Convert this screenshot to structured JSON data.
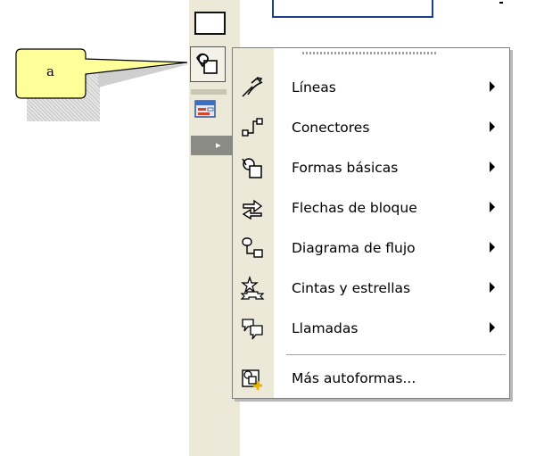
{
  "callout": {
    "label": "a"
  },
  "toolbar": {
    "rectangle_icon": "rectangle-icon",
    "autoshapes_icon": "autoshapes-icon",
    "form_icon": "form-icon",
    "overflow_icon": "overflow-arrow-icon"
  },
  "menu": {
    "items": [
      {
        "label": "Líneas",
        "icon": "lines-icon",
        "submenu": true
      },
      {
        "label": "Conectores",
        "icon": "connectors-icon",
        "submenu": true
      },
      {
        "label": "Formas básicas",
        "icon": "basic-shapes-icon",
        "submenu": true
      },
      {
        "label": "Flechas de bloque",
        "icon": "block-arrows-icon",
        "submenu": true
      },
      {
        "label": "Diagrama de flujo",
        "icon": "flowchart-icon",
        "submenu": true
      },
      {
        "label": "Cintas y estrellas",
        "icon": "stars-banners-icon",
        "submenu": true
      },
      {
        "label": "Llamadas",
        "icon": "callouts-icon",
        "submenu": true
      },
      {
        "label": "Más autoformas...",
        "icon": "more-autoshapes-icon",
        "submenu": false
      }
    ]
  },
  "colors": {
    "toolbar_bg": "#ece9d8",
    "callout_fill": "#ffff99",
    "doc_frame": "#1e3f8a"
  }
}
